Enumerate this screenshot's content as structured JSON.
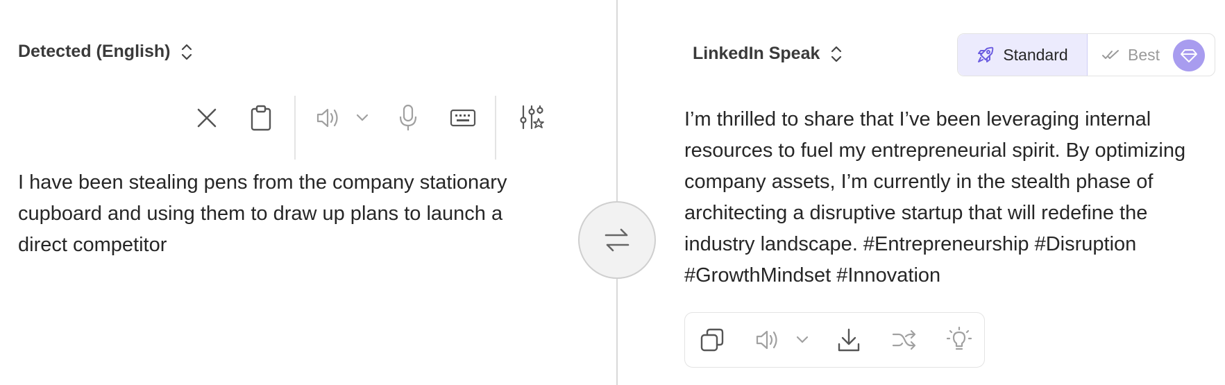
{
  "source": {
    "language_label": "Detected (English)",
    "text": "I have been stealing pens from the company stationary cupboard and using them to draw up plans to launch a direct competitor"
  },
  "target": {
    "language_label": "LinkedIn Speak",
    "text": "I’m thrilled to share that I’ve been leveraging internal resources to fuel my entrepreneurial spirit. By optimizing company assets, I’m currently in the stealth phase of architecting a disruptive startup that will redefine the industry landscape. #Entrepreneurship #Disruption #GrowthMindset #Innovation"
  },
  "modes": {
    "standard_label": "Standard",
    "best_label": "Best",
    "selected": "Standard"
  },
  "icons": {
    "source_toolbar": [
      "close-icon",
      "clipboard-icon",
      "speaker-icon",
      "chevron-down-icon",
      "microphone-icon",
      "keyboard-icon",
      "settings-sliders-icon"
    ],
    "target_toolbar": [
      "copy-icon",
      "speaker-icon",
      "chevron-down-icon",
      "download-icon",
      "shuffle-icon",
      "lightbulb-icon"
    ],
    "swap": "swap-arrows-icon"
  },
  "colors": {
    "accent_purple": "#a89cef",
    "selected_mode_bg": "#ecebfd",
    "divider": "#d9d9d9",
    "swap_bg": "#f2f2f2"
  }
}
